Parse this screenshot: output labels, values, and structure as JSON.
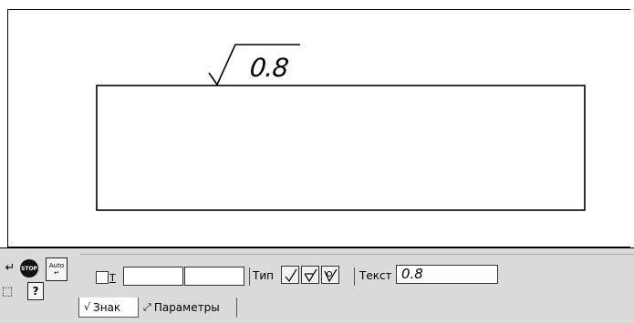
{
  "drawing": {
    "roughness_value": "0.8"
  },
  "toolbar": {
    "enter_icon": "↵",
    "stop_icon": "STOP",
    "auto_label_top": "Auto",
    "auto_label_bottom": "↵",
    "frame_icon": "⬚",
    "help_icon": "?"
  },
  "params": {
    "checkbox_label": "T",
    "type_label": "Тип",
    "text_label": "Текст",
    "text_value": "0.8",
    "type_buttons": [
      "roughness-basic-icon",
      "roughness-removal-icon",
      "roughness-no-removal-icon"
    ]
  },
  "tabs": {
    "znak": "Знак",
    "parametry": "Параметры"
  }
}
